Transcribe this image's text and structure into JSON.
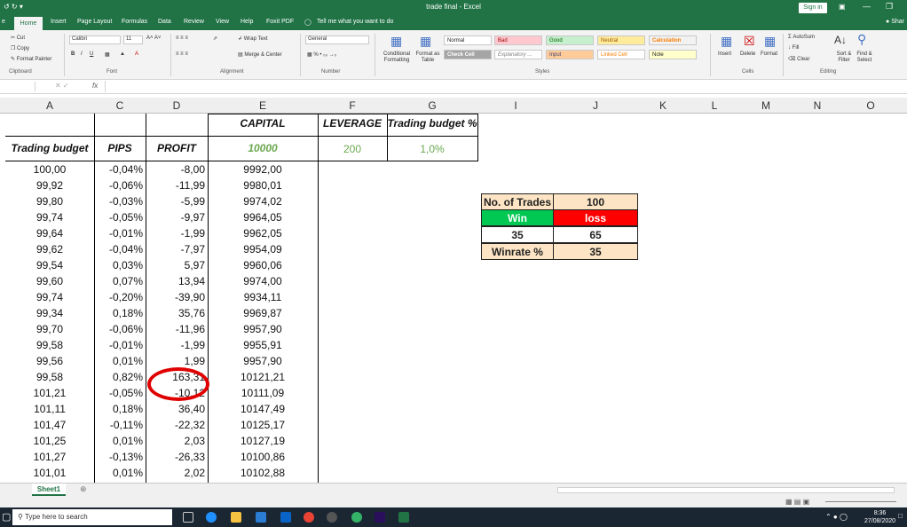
{
  "window": {
    "title": "trade final - Excel",
    "sign_in": "Sign in"
  },
  "menu": {
    "file": "e",
    "home": "Home",
    "insert": "Insert",
    "page_layout": "Page Layout",
    "formulas": "Formulas",
    "data": "Data",
    "review": "Review",
    "view": "View",
    "help": "Help",
    "foxit": "Foxit PDF",
    "tell_me": "Tell me what you want to do",
    "share": "Shar"
  },
  "ribbon": {
    "cut": "Cut",
    "copy": "Copy",
    "format_painter": "Format Painter",
    "clipboard": "Clipboard",
    "font_name": "Calibri",
    "font_size": "11",
    "font": "Font",
    "wrap_text": "Wrap Text",
    "merge_center": "Merge & Center",
    "alignment": "Alignment",
    "number_format": "General",
    "number": "Number",
    "conditional": "Conditional Formatting",
    "format_table": "Format as Table",
    "styles": "Styles",
    "insert": "Insert",
    "delete": "Delete",
    "format": "Format",
    "cells": "Cells",
    "autosum": "AutoSum",
    "fill": "Fill",
    "clear": "Clear",
    "sort": "Sort & Filter",
    "find": "Find & Select",
    "editing": "Editing",
    "style_normal": "Normal",
    "style_bad": "Bad",
    "style_good": "Good",
    "style_neutral": "Neutral",
    "style_calculation": "Calculation",
    "style_check": "Check Cell",
    "style_explanatory": "Explanatory ...",
    "style_input": "Input",
    "style_linked": "Linked Cell",
    "style_note": "Note"
  },
  "formula_bar": {
    "fx": "fx",
    "value": ""
  },
  "columns": [
    "A",
    "C",
    "D",
    "E",
    "F",
    "G",
    "I",
    "J",
    "K",
    "L",
    "M",
    "N",
    "O"
  ],
  "headers": {
    "capital": "CAPITAL",
    "leverage": "LEVERAGE",
    "trading_budget_pct": "Trading budget %",
    "trading_budget": "Trading budget",
    "pips": "PIPS",
    "profit": "PROFIT",
    "capital_value": "10000",
    "leverage_value": "200",
    "budget_pct_value": "1,0%"
  },
  "rows": [
    [
      "100,00",
      "-0,04%",
      "-8,00",
      "9992,00"
    ],
    [
      "99,92",
      "-0,06%",
      "-11,99",
      "9980,01"
    ],
    [
      "99,80",
      "-0,03%",
      "-5,99",
      "9974,02"
    ],
    [
      "99,74",
      "-0,05%",
      "-9,97",
      "9964,05"
    ],
    [
      "99,64",
      "-0,01%",
      "-1,99",
      "9962,05"
    ],
    [
      "99,62",
      "-0,04%",
      "-7,97",
      "9954,09"
    ],
    [
      "99,54",
      "0,03%",
      "5,97",
      "9960,06"
    ],
    [
      "99,60",
      "0,07%",
      "13,94",
      "9974,00"
    ],
    [
      "99,74",
      "-0,20%",
      "-39,90",
      "9934,11"
    ],
    [
      "99,34",
      "0,18%",
      "35,76",
      "9969,87"
    ],
    [
      "99,70",
      "-0,06%",
      "-11,96",
      "9957,90"
    ],
    [
      "99,58",
      "-0,01%",
      "-1,99",
      "9955,91"
    ],
    [
      "99,56",
      "0,01%",
      "1,99",
      "9957,90"
    ],
    [
      "99,58",
      "0,82%",
      "163,31",
      "10121,21"
    ],
    [
      "101,21",
      "-0,05%",
      "-10,12",
      "10111,09"
    ],
    [
      "101,11",
      "0,18%",
      "36,40",
      "10147,49"
    ],
    [
      "101,47",
      "-0,11%",
      "-22,32",
      "10125,17"
    ],
    [
      "101,25",
      "0,01%",
      "2,03",
      "10127,19"
    ],
    [
      "101,27",
      "-0,13%",
      "-26,33",
      "10100,86"
    ],
    [
      "101,01",
      "0,01%",
      "2,02",
      "10102,88"
    ]
  ],
  "summary": {
    "no_trades_label": "No. of Trades",
    "no_trades": "100",
    "win_label": "Win",
    "loss_label": "loss",
    "wins": "35",
    "losses": "65",
    "winrate_label": "Winrate %",
    "winrate": "35"
  },
  "sheet_tab": "Sheet1",
  "taskbar": {
    "search": "Type here to search",
    "time": "8:36",
    "date": "27/08/2020"
  },
  "colors": {
    "excel_green": "#217346",
    "header_fill": "#fce4c4",
    "win_fill": "#00c853",
    "loss_fill": "#ff0000",
    "circle": "#e00000"
  }
}
